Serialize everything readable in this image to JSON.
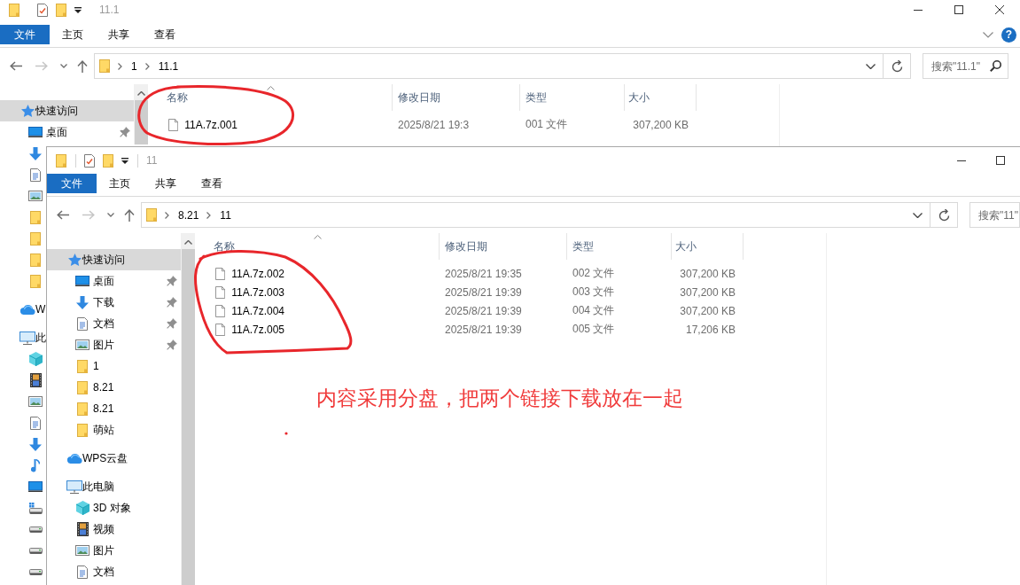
{
  "back_window": {
    "title": "11.1",
    "quick_toolbar": [
      {
        "kind": "folder"
      },
      {
        "kind": "checklist"
      },
      {
        "kind": "folder"
      },
      {
        "kind": "dropdown"
      }
    ],
    "toolbar_separators": false,
    "window_controls": [
      {
        "kind": "minimize"
      },
      {
        "kind": "maximize"
      },
      {
        "kind": "close"
      }
    ],
    "ribbon_tabs": [
      {
        "label": "文件",
        "kind": "file"
      },
      {
        "label": "主页",
        "kind": "tab"
      },
      {
        "label": "共享",
        "kind": "tab"
      },
      {
        "label": "查看",
        "kind": "tab"
      }
    ],
    "help": "?",
    "nav": [
      {
        "kind": "back",
        "disabled": false
      },
      {
        "kind": "forward",
        "disabled": true
      },
      {
        "kind": "recent",
        "disabled": false
      },
      {
        "kind": "up",
        "disabled": false
      }
    ],
    "path": [
      "1",
      "11.1"
    ],
    "search": {
      "placeholder": "搜索\"11.1\"",
      "icon": true
    },
    "sidebar": [
      {
        "label": "快速访问",
        "kind": "star",
        "selected": true,
        "children": [
          {
            "label": "桌面",
            "kind": "desktop",
            "pinned": true,
            "selected": false
          },
          {
            "kind": "download",
            "pinned": false,
            "selected": false
          },
          {
            "kind": "document",
            "pinned": false,
            "selected": false
          },
          {
            "kind": "picture",
            "pinned": false,
            "selected": false
          },
          {
            "kind": "folder",
            "pinned": false,
            "selected": false
          },
          {
            "kind": "folder",
            "pinned": false,
            "selected": false
          },
          {
            "kind": "folder",
            "pinned": false,
            "selected": false
          },
          {
            "kind": "folder",
            "pinned": false,
            "selected": false
          }
        ]
      },
      {
        "label": "W",
        "kind": "cloud",
        "selected": false
      },
      {
        "label": "此",
        "kind": "computer",
        "selected": false,
        "children": [
          {
            "kind": "cube",
            "selected": false
          },
          {
            "kind": "video",
            "selected": false
          },
          {
            "kind": "picture",
            "selected": false
          },
          {
            "kind": "document",
            "selected": false
          },
          {
            "kind": "download",
            "selected": false
          },
          {
            "kind": "music",
            "selected": false
          },
          {
            "kind": "desktop",
            "selected": false
          },
          {
            "kind": "drive-system",
            "selected": false
          },
          {
            "kind": "drive",
            "selected": false
          },
          {
            "kind": "drive",
            "selected": false
          },
          {
            "kind": "drive",
            "selected": false
          }
        ]
      }
    ],
    "columns": [
      {
        "label": "名称",
        "sorted": true
      },
      {
        "label": "修改日期",
        "sorted": false
      },
      {
        "label": "类型",
        "sorted": false
      },
      {
        "label": "大小",
        "sorted": false
      }
    ],
    "files": [
      {
        "name": "11A.7z.001",
        "modified": "2025/8/21 19:3",
        "type": "001 文件",
        "size": "307,200 KB"
      }
    ]
  },
  "front_window": {
    "title": "11",
    "quick_toolbar": [
      {
        "kind": "folder"
      },
      {
        "kind": "checklist"
      },
      {
        "kind": "folder"
      },
      {
        "kind": "dropdown"
      }
    ],
    "toolbar_separators": true,
    "window_controls": [
      {
        "kind": "minimize"
      },
      {
        "kind": "maximize"
      }
    ],
    "ribbon_tabs": [
      {
        "label": "文件",
        "kind": "file"
      },
      {
        "label": "主页",
        "kind": "tab"
      },
      {
        "label": "共享",
        "kind": "tab"
      },
      {
        "label": "查看",
        "kind": "tab"
      }
    ],
    "nav": [
      {
        "kind": "back",
        "disabled": false
      },
      {
        "kind": "forward",
        "disabled": true
      },
      {
        "kind": "recent",
        "disabled": false
      },
      {
        "kind": "up",
        "disabled": false
      }
    ],
    "path": [
      "8.21",
      "11"
    ],
    "search": {
      "placeholder": "搜索\"11\"",
      "icon": false
    },
    "sidebar": [
      {
        "label": "快速访问",
        "kind": "star",
        "selected": true,
        "children": [
          {
            "label": "桌面",
            "kind": "desktop",
            "pinned": true,
            "selected": false
          },
          {
            "label": "下载",
            "kind": "download",
            "pinned": true,
            "selected": false
          },
          {
            "label": "文档",
            "kind": "document",
            "pinned": true,
            "selected": false
          },
          {
            "label": "图片",
            "kind": "picture",
            "pinned": true,
            "selected": false
          },
          {
            "label": "1",
            "kind": "folder",
            "pinned": false,
            "selected": false
          },
          {
            "label": "8.21",
            "kind": "folder",
            "pinned": false,
            "selected": false
          },
          {
            "label": "8.21",
            "kind": "folder",
            "pinned": false,
            "selected": false
          },
          {
            "label": "萌站",
            "kind": "folder",
            "pinned": false,
            "selected": false
          }
        ]
      },
      {
        "label": "WPS云盘",
        "kind": "cloud",
        "selected": false
      },
      {
        "label": "此电脑",
        "kind": "computer",
        "selected": false,
        "children": [
          {
            "label": "3D 对象",
            "kind": "cube",
            "selected": false
          },
          {
            "label": "视频",
            "kind": "video",
            "selected": false
          },
          {
            "label": "图片",
            "kind": "picture",
            "selected": false
          },
          {
            "label": "文档",
            "kind": "document",
            "selected": false
          }
        ]
      }
    ],
    "columns": [
      {
        "label": "名称",
        "sorted": true
      },
      {
        "label": "修改日期",
        "sorted": false
      },
      {
        "label": "类型",
        "sorted": false
      },
      {
        "label": "大小",
        "sorted": false
      }
    ],
    "files": [
      {
        "name": "11A.7z.002",
        "modified": "2025/8/21 19:35",
        "type": "002 文件",
        "size": "307,200 KB"
      },
      {
        "name": "11A.7z.003",
        "modified": "2025/8/21 19:39",
        "type": "003 文件",
        "size": "307,200 KB"
      },
      {
        "name": "11A.7z.004",
        "modified": "2025/8/21 19:39",
        "type": "004 文件",
        "size": "307,200 KB"
      },
      {
        "name": "11A.7z.005",
        "modified": "2025/8/21 19:39",
        "type": "005 文件",
        "size": "17,206 KB"
      }
    ]
  },
  "annotations": {
    "marks": [
      {
        "kind": "ellipse"
      },
      {
        "kind": "loop"
      },
      {
        "kind": "dot"
      }
    ],
    "note": "内容采用分盘，把两个链接下载放在一起"
  }
}
